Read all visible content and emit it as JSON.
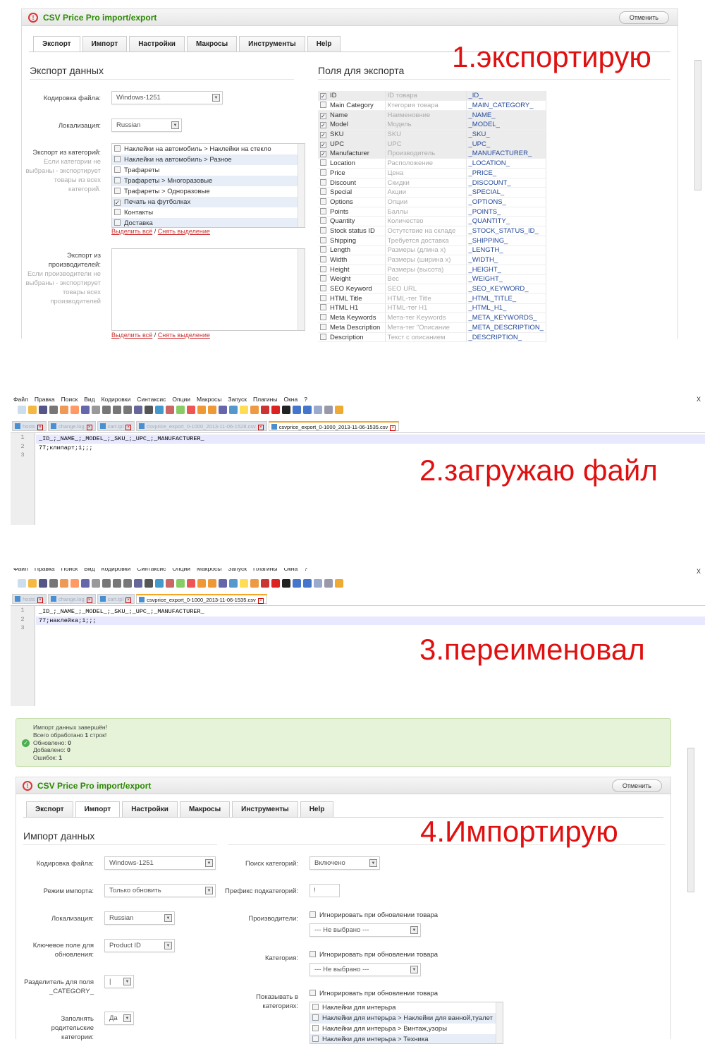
{
  "app": {
    "title": "CSV Price Pro import/export",
    "cancel": "Отменить"
  },
  "tabs": [
    "Экспорт",
    "Импорт",
    "Настройки",
    "Макросы",
    "Инструменты",
    "Help"
  ],
  "annotations": [
    "1.экспортирую",
    "2.загружаю файл",
    "3.переименовал",
    "4.Импортирую"
  ],
  "export": {
    "title": "Экспорт данных",
    "fields_title": "Поля для экспорта",
    "encoding_label": "Кодировка файла:",
    "encoding": "Windows-1251",
    "locale_label": "Локализация:",
    "locale": "Russian",
    "cat_label": "Экспорт из категорий:",
    "cat_hint": "Если категории не выбраны - экспортирует товары из всех категорий.",
    "categories": [
      {
        "t": "Наклейки на автомобиль > Наклейки на стекло",
        "c": false
      },
      {
        "t": "Наклейки на автомобиль > Разное",
        "c": false
      },
      {
        "t": "Трафареты",
        "c": false
      },
      {
        "t": "Трафареты > Многоразовые",
        "c": false
      },
      {
        "t": "Трафареты > Одноразовые",
        "c": false
      },
      {
        "t": "Печать на футболках",
        "c": true
      },
      {
        "t": "Контакты",
        "c": false
      },
      {
        "t": "Доставка",
        "c": false
      }
    ],
    "select_all": "Выделить всё",
    "sep": "/",
    "deselect": "Снять выделение",
    "man_label": "Экспорт из производителей:",
    "man_hint": "Если производители не выбраны - экспортирует товары всех производителей",
    "fields": [
      [
        "ID",
        "ID товара",
        "_ID_",
        true
      ],
      [
        "Main Category",
        "Ктегория товара",
        "_MAIN_CATEGORY_",
        false
      ],
      [
        "Name",
        "Наименовние",
        "_NAME_",
        true
      ],
      [
        "Model",
        "Модель",
        "_MODEL_",
        true
      ],
      [
        "SKU",
        "SKU",
        "_SKU_",
        true
      ],
      [
        "UPC",
        "UPC",
        "_UPC_",
        true
      ],
      [
        "Manufacturer",
        "Производитель",
        "_MANUFACTURER_",
        true
      ],
      [
        "Location",
        "Расположение",
        "_LOCATION_",
        false
      ],
      [
        "Price",
        "Цена",
        "_PRICE_",
        false
      ],
      [
        "Discount",
        "Скидки",
        "_DISCOUNT_",
        false
      ],
      [
        "Special",
        "Акции",
        "_SPECIAL_",
        false
      ],
      [
        "Options",
        "Опции",
        "_OPTIONS_",
        false
      ],
      [
        "Points",
        "Баллы",
        "_POINTS_",
        false
      ],
      [
        "Quantity",
        "Количество",
        "_QUANTITY_",
        false
      ],
      [
        "Stock status ID",
        "Остутствие на складе",
        "_STOCK_STATUS_ID_",
        false
      ],
      [
        "Shipping",
        "Требуется доставка",
        "_SHIPPING_",
        false
      ],
      [
        "Length",
        "Размеры (длина x)",
        "_LENGTH_",
        false
      ],
      [
        "Width",
        "Размеры (ширина x)",
        "_WIDTH_",
        false
      ],
      [
        "Height",
        "Размеры (высота)",
        "_HEIGHT_",
        false
      ],
      [
        "Weight",
        "Вес",
        "_WEIGHT_",
        false
      ],
      [
        "SEO Keyword",
        "SEO URL",
        "_SEO_KEYWORD_",
        false
      ],
      [
        "HTML Title",
        "HTML-тег Title",
        "_HTML_TITLE_",
        false
      ],
      [
        "HTML H1",
        "HTML-тег H1",
        "_HTML_H1_",
        false
      ],
      [
        "Meta Keywords",
        "Мета-тег Keywords",
        "_META_KEYWORDS_",
        false
      ],
      [
        "Meta Description",
        "Мета-тег \"Описание",
        "_META_DESCRIPTION_",
        false
      ],
      [
        "Description",
        "Текст с описанием",
        "_DESCRIPTION_",
        false
      ]
    ]
  },
  "editor": {
    "menu": [
      "Файл",
      "Правка",
      "Поиск",
      "Вид",
      "Кодировки",
      "Синтаксис",
      "Опции",
      "Макросы",
      "Запуск",
      "Плагины",
      "Окна",
      "?"
    ],
    "close": "X",
    "tabs1": [
      "hosts",
      "change.log",
      "cart.tpl",
      "csvprice_export_0-1000_2013-11-06-1528.csv",
      "csvprice_export_0-1000_2013-11-06-1535.csv"
    ],
    "tabs2": [
      "hosts",
      "change.log",
      "cart.tpl",
      "csvprice_export_0-1000_2013-11-06-1535.csv"
    ],
    "lines1": [
      "_ID_;_NAME_;_MODEL_;_SKU_;_UPC_;_MANUFACTURER_",
      "77;клипарт;1;;;",
      ""
    ],
    "lines2": [
      "_ID_;_NAME_;_MODEL_;_SKU_;_UPC_;_MANUFACTURER_",
      "77;наклейка;1;;;",
      ""
    ]
  },
  "result": {
    "l1": "Импорт данных завершён!",
    "l2a": "Всего обработано ",
    "l2b": "1",
    "l2c": " строк!",
    "l3a": "Обновлено: ",
    "l3b": "0",
    "l4a": "Добавлено: ",
    "l4b": "0",
    "l5a": "Ошибок: ",
    "l5b": "1"
  },
  "import": {
    "title": "Импорт данных",
    "encoding_label": "Кодировка файла:",
    "encoding": "Windows-1251",
    "mode_label": "Режим импорта:",
    "mode": "Только обновить",
    "locale_label": "Локализация:",
    "locale": "Russian",
    "key_label": "Ключевое поле для обновления:",
    "key": "Product ID",
    "delim_label": "Разделитель для поля _CATEGORY_",
    "delim": "|",
    "fill_label": "Заполнять родительские категории:",
    "fill": "Да",
    "catsearch_label": "Поиск категорий:",
    "catsearch": "Включено",
    "prefix_label": "Префикс подкатегорий:",
    "prefix": "!",
    "man_label": "Производители:",
    "ignore": "Игнорировать при обновлении товара",
    "none": "--- Не выбрано ---",
    "cat_label": "Категория:",
    "show_label": "Показывать в категориях:",
    "show_cats": [
      "Наклейки для интерьра",
      "Наклейки для интерьра > Наклейки для ванной,туалет",
      "Наклейки для интерьра > Винтаж,узоры",
      "Наклейки для интерьра > Техника"
    ]
  },
  "colors": {
    "accent": "#2a8a00",
    "annotation": "#e01010",
    "link": "#cc3333"
  }
}
